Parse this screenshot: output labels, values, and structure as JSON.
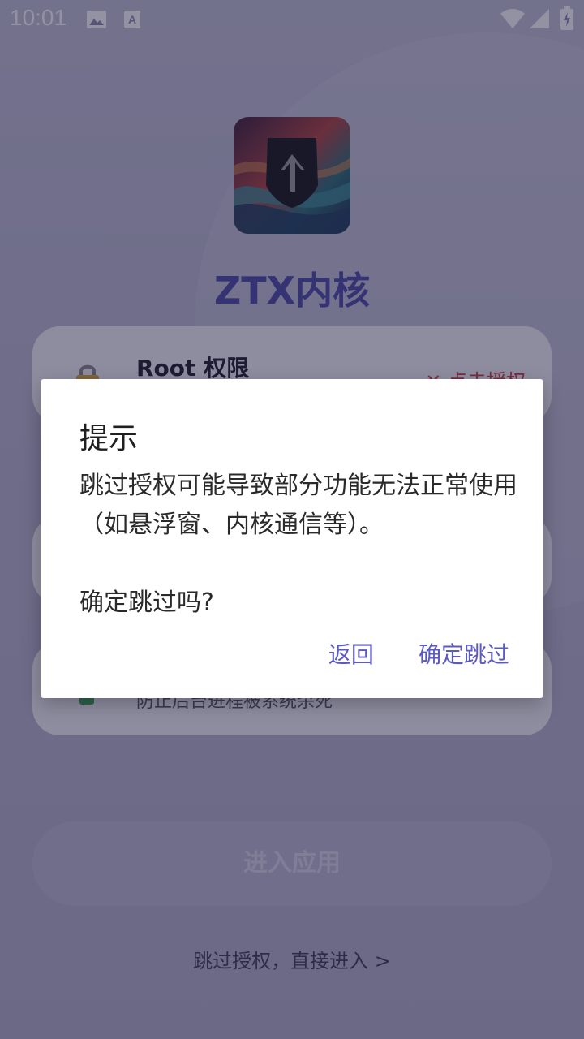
{
  "status_bar": {
    "time": "10:01",
    "left_icons": [
      "image-icon",
      "font-download-icon"
    ],
    "right_icons": [
      "wifi-icon",
      "signal-icon",
      "battery-charging-icon"
    ]
  },
  "app": {
    "title": "ZTX内核",
    "logo_icon": "app-logo-icon"
  },
  "cards": [
    {
      "title": "Root 权限",
      "status": "✕ 点击授权",
      "icon": "lock-icon"
    },
    {
      "title": "",
      "status": "",
      "icon": ""
    },
    {
      "title": "",
      "subtitle": "防止后台进程被系统杀死",
      "icon": "check-icon"
    }
  ],
  "enter_button": "进入应用",
  "skip_link": "跳过授权，直接进入 >",
  "dialog": {
    "title": "提示",
    "message_line1": "跳过授权可能导致部分功能无法正常使用（如悬浮窗、内核通信等）。",
    "message_line2": "确定跳过吗?",
    "negative_button": "返回",
    "positive_button": "确定跳过"
  },
  "colors": {
    "accent": "#5b59c4",
    "title": "#4b4aa8",
    "warning": "#d23b3b"
  }
}
